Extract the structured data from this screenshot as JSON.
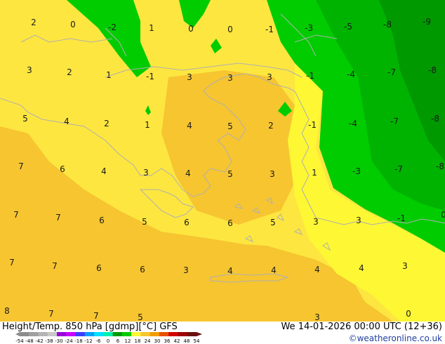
{
  "footer": {
    "title": "Height/Temp. 850 hPa [gdmp][°C] GFS",
    "datetime": "We 14-01-2026 00:00 UTC (12+36)",
    "credit": "©weatheronline.co.uk"
  },
  "colors": {
    "warm_orange": "#f6c530",
    "yellow": "#fde640",
    "bright_yellow": "#fef734",
    "green_light": "#00cc00",
    "green_mid": "#00b300",
    "green_dark": "#009900",
    "coast": "#b0b0b0"
  },
  "temperature_labels": [
    {
      "v": "2"
    },
    {
      "v": "0"
    },
    {
      "v": "-2"
    },
    {
      "v": "1"
    },
    {
      "v": "0"
    },
    {
      "v": "0"
    },
    {
      "v": "-1"
    },
    {
      "v": "-3"
    },
    {
      "v": "-5"
    },
    {
      "v": "-8"
    },
    {
      "v": "-9"
    },
    {
      "v": "3"
    },
    {
      "v": "2"
    },
    {
      "v": "1"
    },
    {
      "v": "-1"
    },
    {
      "v": "3"
    },
    {
      "v": "3"
    },
    {
      "v": "3"
    },
    {
      "v": "-1"
    },
    {
      "v": "-4"
    },
    {
      "v": "-7"
    },
    {
      "v": "-8"
    },
    {
      "v": "5"
    },
    {
      "v": "4"
    },
    {
      "v": "2"
    },
    {
      "v": "1"
    },
    {
      "v": "4"
    },
    {
      "v": "5"
    },
    {
      "v": "2"
    },
    {
      "v": "-1"
    },
    {
      "v": "-4"
    },
    {
      "v": "-7"
    },
    {
      "v": "-8"
    },
    {
      "v": "7"
    },
    {
      "v": "6"
    },
    {
      "v": "4"
    },
    {
      "v": "3"
    },
    {
      "v": "4"
    },
    {
      "v": "5"
    },
    {
      "v": "3"
    },
    {
      "v": "1"
    },
    {
      "v": "-3"
    },
    {
      "v": "-7"
    },
    {
      "v": "-8"
    },
    {
      "v": "7"
    },
    {
      "v": "7"
    },
    {
      "v": "6"
    },
    {
      "v": "5"
    },
    {
      "v": "6"
    },
    {
      "v": "6"
    },
    {
      "v": "5"
    },
    {
      "v": "3"
    },
    {
      "v": "3"
    },
    {
      "v": "-1"
    },
    {
      "v": "0"
    },
    {
      "v": "7"
    },
    {
      "v": "7"
    },
    {
      "v": "6"
    },
    {
      "v": "6"
    },
    {
      "v": "3"
    },
    {
      "v": "4"
    },
    {
      "v": "4"
    },
    {
      "v": "4"
    },
    {
      "v": "4"
    },
    {
      "v": "3"
    },
    {
      "v": "8"
    },
    {
      "v": "7"
    },
    {
      "v": "7"
    },
    {
      "v": "5"
    },
    {
      "v": "3"
    },
    {
      "v": "0"
    }
  ],
  "legend": {
    "ticks": [
      "-54",
      "-48",
      "-42",
      "-38",
      "-30",
      "-24",
      "-18",
      "-12",
      "-6",
      "0",
      "6",
      "12",
      "18",
      "24",
      "30",
      "36",
      "42",
      "48",
      "54"
    ],
    "colors": [
      "#8c8c8c",
      "#a0a0a0",
      "#b4b4b4",
      "#c8c8c8",
      "#9a00d8",
      "#c800ff",
      "#3c3cff",
      "#00a0ff",
      "#00e0ff",
      "#00f0b0",
      "#009900",
      "#00cc00",
      "#fef734",
      "#f6c530",
      "#f49c00",
      "#e85000",
      "#d40000",
      "#a00000",
      "#6a1010"
    ]
  }
}
